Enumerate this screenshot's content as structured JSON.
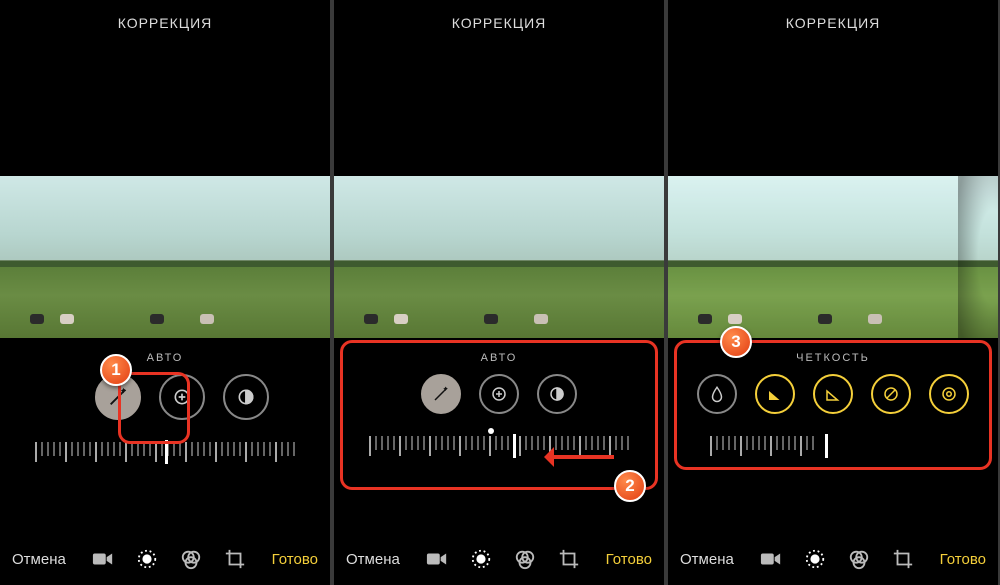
{
  "header_title": "КОРРЕКЦИЯ",
  "footer": {
    "cancel": "Отмена",
    "done": "Готово"
  },
  "panes": [
    {
      "adjust_label": "АВТО"
    },
    {
      "adjust_label": "АВТО"
    },
    {
      "adjust_label": "ЧЕТКОСТЬ"
    }
  ],
  "callouts": {
    "c1": "1",
    "c2": "2",
    "c3": "3"
  }
}
